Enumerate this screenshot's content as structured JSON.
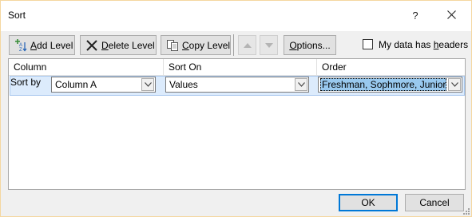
{
  "window": {
    "title": "Sort",
    "help": "?",
    "close": "✕"
  },
  "toolbar": {
    "add_level": {
      "mnemonic": "A",
      "rest": "dd Level"
    },
    "delete_level": {
      "mnemonic": "D",
      "rest": "elete Level"
    },
    "copy_level": {
      "mnemonic": "C",
      "rest": "opy Level"
    },
    "move_up": "move up",
    "move_down": "move down",
    "options": {
      "mnemonic": "O",
      "rest": "ptions..."
    },
    "headers_checkbox": {
      "prefix": "My data has ",
      "mnemonic": "h",
      "rest": "eaders",
      "checked": false
    }
  },
  "grid": {
    "headers": {
      "column": "Column",
      "sort_on": "Sort On",
      "order": "Order"
    },
    "rows": [
      {
        "label": "Sort by",
        "column": "Column A",
        "sort_on": "Values",
        "order": "Freshman, Sophmore, Junior, S"
      }
    ]
  },
  "footer": {
    "ok": "OK",
    "cancel": "Cancel"
  },
  "colors": {
    "accent": "#0078d7",
    "selection": "#99c9ef",
    "row_highlight": "#dcebfc",
    "dialog_border": "#f5d7a0"
  }
}
